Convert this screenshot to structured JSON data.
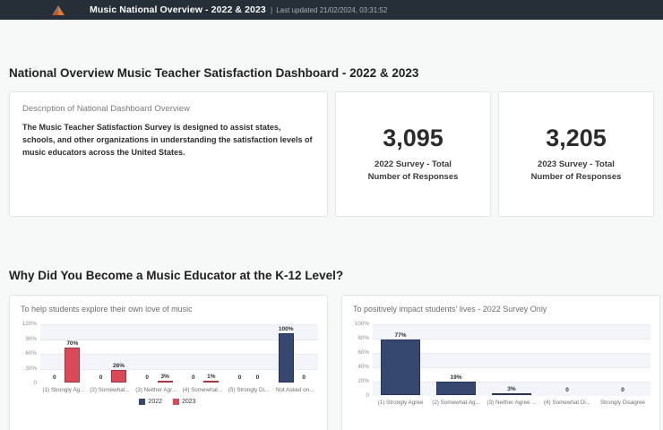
{
  "header": {
    "title": "Music National Overview - 2022 & 2023",
    "separator": "|",
    "last_updated": "Last updated 21/02/2024, 03:31:52",
    "bg_color": "#262e38",
    "logo_colors": {
      "slate": "#717c8c",
      "orange": "#e8762e",
      "dark_orange": "#bf5a1f"
    }
  },
  "page": {
    "title": "National Overview Music Teacher Satisfaction Dashboard - 2022 & 2023",
    "section_heading": "Why Did You Become a Music Educator at the K-12 Level?"
  },
  "description_card": {
    "title": "Description of National Dashboard Overview",
    "body": "The Music Teacher Satisfaction Survey is designed to assist states, schools, and other organizations in understanding the satisfaction levels of music educators across the United States."
  },
  "kpi_cards": [
    {
      "value": "3,095",
      "label": "2022 Survey - Total Number of Responses"
    },
    {
      "value": "3,205",
      "label": "2023 Survey - Total Number of Responses"
    }
  ],
  "colors": {
    "bar_blue": "#36486f",
    "bar_blue_border": "#253455",
    "bar_red": "#d94a59",
    "bar_red_border": "#a83341",
    "stripe": "#f3f5fb"
  },
  "chart_data": [
    {
      "type": "bar",
      "title": "To help students explore their own love of music",
      "categories": [
        "(1) Strongly Ag...",
        "(2) Somewhat...",
        "(3) Neither Agr...",
        "(4) Somewhat...",
        "(5) Strongly Di...",
        "Not Asked on..."
      ],
      "series": [
        {
          "name": "2022",
          "color": "#36486f",
          "border": "#253455",
          "values": [
            0,
            0,
            0,
            0,
            0,
            100
          ],
          "labels": [
            "0",
            "0",
            "0",
            "0",
            "0",
            "100%"
          ]
        },
        {
          "name": "2023",
          "color": "#d94a59",
          "border": "#a83341",
          "values": [
            70,
            26,
            3,
            1,
            0,
            0
          ],
          "labels": [
            "70%",
            "26%",
            "3%",
            "1%",
            "0",
            "0"
          ]
        }
      ],
      "ylim": [
        0,
        120
      ],
      "yticks": [
        "0",
        "30%",
        "60%",
        "90%",
        "120%"
      ],
      "legend": [
        "2022",
        "2023"
      ],
      "grid": true,
      "legend_position": "bottom"
    },
    {
      "type": "bar",
      "title": "To positively impact students' lives - 2022 Survey Only",
      "categories": [
        "(1) Strongly Agree",
        "(2) Somewhat Ag...",
        "(3) Neither Agree ...",
        "(4) Somewhat Di...",
        "Strongly Disagree"
      ],
      "series": [
        {
          "name": "2022",
          "color": "#36486f",
          "border": "#253455",
          "values": [
            77,
            19,
            3,
            0,
            0
          ],
          "labels": [
            "77%",
            "19%",
            "3%",
            "0",
            "0"
          ]
        }
      ],
      "ylim": [
        0,
        100
      ],
      "yticks": [
        "0",
        "20%",
        "40%",
        "60%",
        "80%",
        "100%"
      ],
      "legend": [],
      "grid": true,
      "legend_position": "none"
    }
  ]
}
